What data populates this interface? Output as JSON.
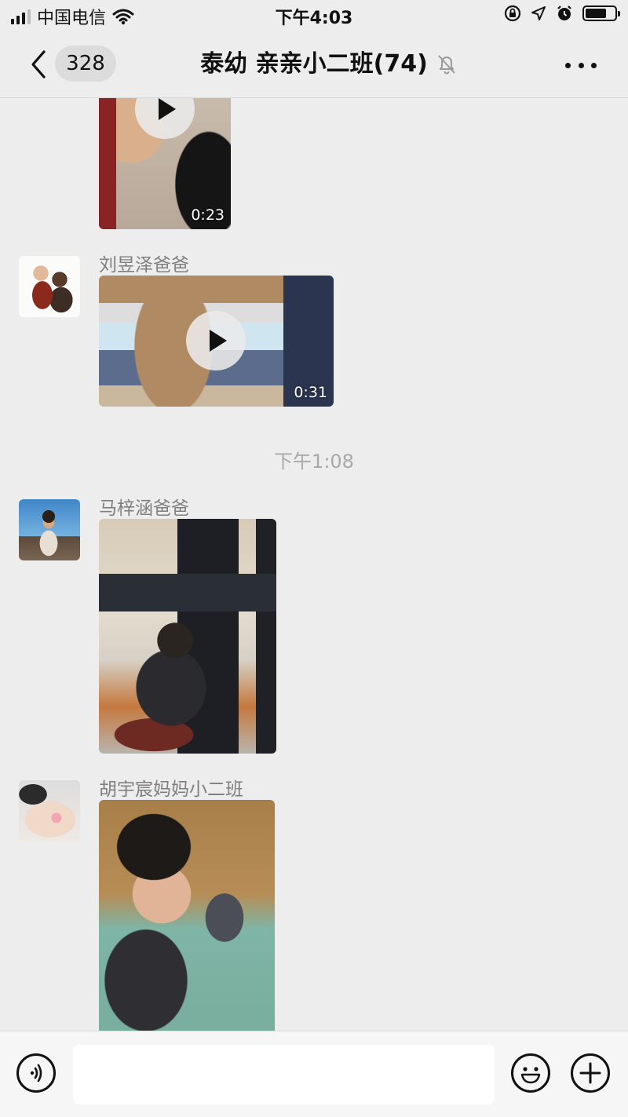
{
  "status_bar": {
    "carrier": "中国电信",
    "time": "下午4:03",
    "icons": [
      "signal-icon",
      "wifi-icon",
      "orientation-lock-icon",
      "location-arrow-icon",
      "alarm-icon",
      "battery-icon"
    ]
  },
  "nav": {
    "back_icon": "chevron-left-icon",
    "unread_count": "328",
    "title": "泰幼 亲亲小二班(74)",
    "mute_icon": "bell-muted-icon",
    "more_icon": "more-dots-icon"
  },
  "messages": [
    {
      "type": "video",
      "sender": "",
      "duration": "0:23"
    },
    {
      "type": "video",
      "sender": "刘昱泽爸爸",
      "duration": "0:31"
    },
    {
      "type": "timestamp",
      "text": "下午1:08"
    },
    {
      "type": "image",
      "sender": "马梓涵爸爸"
    },
    {
      "type": "image",
      "sender": "胡宇宸妈妈小二班"
    }
  ],
  "input_bar": {
    "voice_icon": "voice-icon",
    "emoji_icon": "emoji-icon",
    "plus_icon": "plus-icon",
    "text_value": ""
  },
  "colors": {
    "background": "#ededed",
    "nav_background": "#ededed",
    "sender_text": "#7f7f7f",
    "timestamp_text": "#a8a8a8",
    "input_bar_background": "#f6f6f6"
  }
}
